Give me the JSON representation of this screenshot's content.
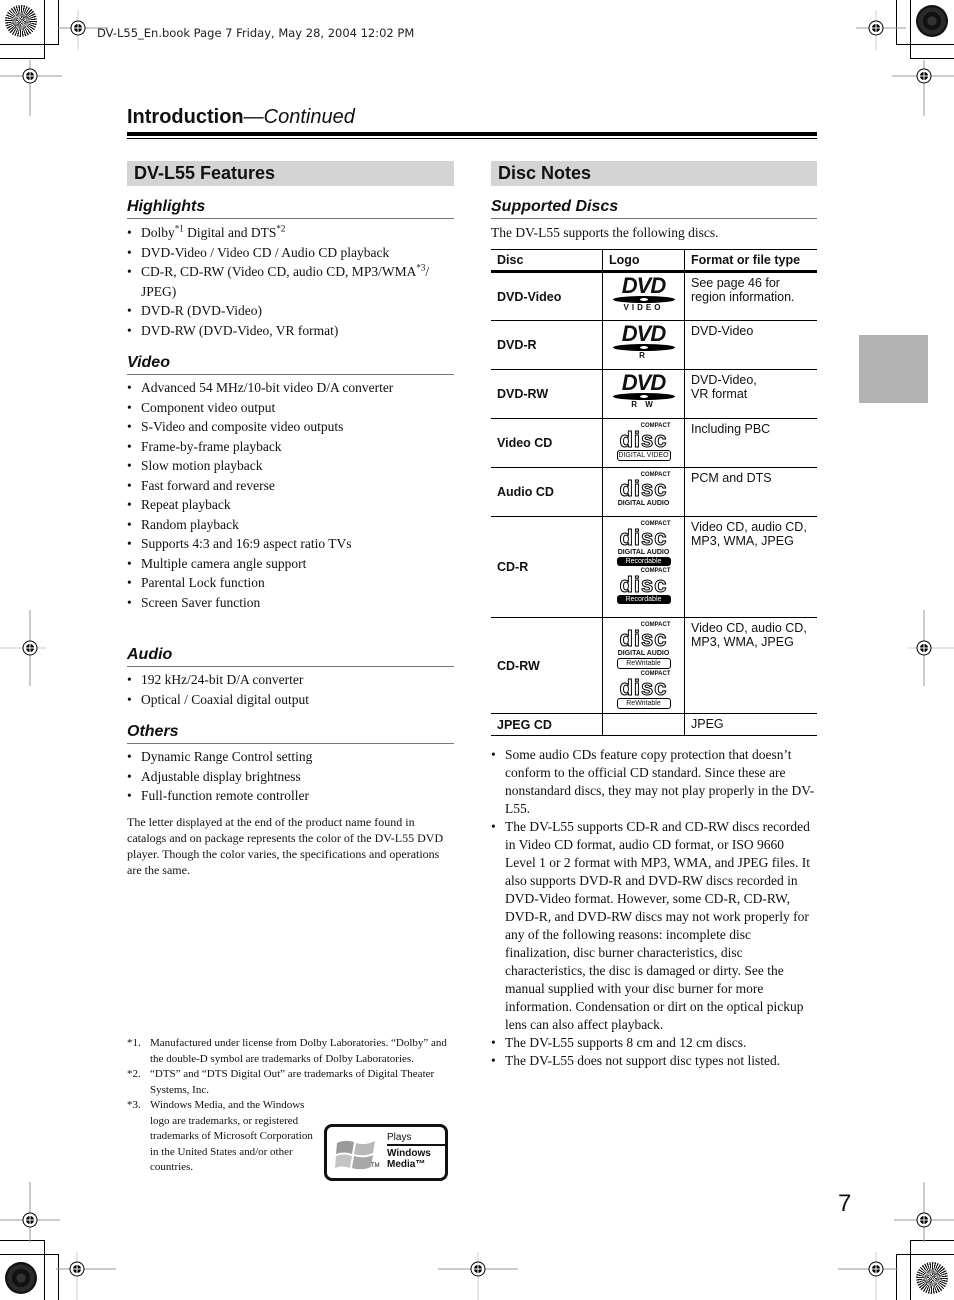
{
  "print_header": "DV-L55_En.book  Page 7  Friday, May 28, 2004  12:02 PM",
  "page": {
    "title": "Introduction",
    "title_continued": "—Continued",
    "number": "7"
  },
  "features": {
    "heading": "DV-L55 Features",
    "highlights": {
      "heading": "Highlights",
      "items": [
        {
          "text": "Dolby",
          "sup": "*1",
          "text2": " Digital and DTS",
          "sup2": "*2"
        },
        {
          "text": "DVD-Video / Video CD / Audio CD playback"
        },
        {
          "text": "CD-R, CD-RW (Video CD, audio CD, MP3/WMA",
          "sup": "*3",
          "text2": "/ JPEG)"
        },
        {
          "text": "DVD-R (DVD-Video)"
        },
        {
          "text": "DVD-RW (DVD-Video, VR format)"
        }
      ]
    },
    "video": {
      "heading": "Video",
      "items": [
        "Advanced 54 MHz/10-bit video D/A converter",
        "Component video output",
        "S-Video and composite video outputs",
        "Frame-by-frame playback",
        "Slow motion playback",
        "Fast forward and reverse",
        "Repeat playback",
        "Random playback",
        "Supports 4:3 and 16:9 aspect ratio TVs",
        "Multiple camera angle support",
        "Parental Lock function",
        "Screen Saver function"
      ]
    },
    "audio": {
      "heading": "Audio",
      "items": [
        "192 kHz/24-bit D/A converter",
        "Optical / Coaxial digital output"
      ]
    },
    "others": {
      "heading": "Others",
      "items": [
        "Dynamic Range Control setting",
        "Adjustable display brightness",
        "Full-function remote controller"
      ]
    },
    "color_note": "The letter displayed at the end of the product name found in catalogs and on package represents the color of the DV-L55 DVD player. Though the color varies, the specifications and operations are the same."
  },
  "footnotes": [
    {
      "num": "*1.",
      "text": "Manufactured under license from Dolby Laboratories. “Dolby” and the double-D symbol are trademarks of Dolby Laboratories."
    },
    {
      "num": "*2.",
      "text": "“DTS” and “DTS Digital Out” are trademarks of Digital Theater Systems, Inc."
    },
    {
      "num": "*3.",
      "text": "Windows Media, and the Windows logo are trademarks, or registered trademarks of Microsoft Corporation in the United States and/or other countries."
    }
  ],
  "windows_media_logo": {
    "line1": "Plays",
    "line2": "Windows",
    "line3": "Media™",
    "tm": "TM"
  },
  "disc_notes": {
    "heading": "Disc Notes",
    "supported": {
      "heading": "Supported Discs",
      "intro": "The DV-L55 supports the following discs.",
      "columns": [
        "Disc",
        "Logo",
        "Format or file type"
      ],
      "rows": [
        {
          "disc": "DVD-Video",
          "logo": "dvd-video-logo",
          "logo_sub": "VIDEO",
          "format": "See page 46 for region information."
        },
        {
          "disc": "DVD-R",
          "logo": "dvd-r-logo",
          "logo_sub": "R",
          "format": "DVD-Video"
        },
        {
          "disc": "DVD-RW",
          "logo": "dvd-rw-logo",
          "logo_sub": "R W",
          "format": "DVD-Video,\nVR format"
        },
        {
          "disc": "Video CD",
          "logo": "compact-disc-digital-video-logo",
          "format": "Including PBC"
        },
        {
          "disc": "Audio CD",
          "logo": "compact-disc-digital-audio-logo",
          "format": "PCM and DTS"
        },
        {
          "disc": "CD-R",
          "logo": "compact-disc-recordable-logos",
          "format": "Video CD, audio CD, MP3, WMA, JPEG"
        },
        {
          "disc": "CD-RW",
          "logo": "compact-disc-rewritable-logos",
          "format": "Video CD, audio CD, MP3, WMA, JPEG"
        },
        {
          "disc": "JPEG CD",
          "logo": "",
          "format": "JPEG"
        }
      ],
      "logo_text": {
        "compact": "COMPACT",
        "disc": "disc",
        "digital_video": "DIGITAL VIDEO",
        "digital_audio": "DIGITAL AUDIO",
        "recordable": "Recordable",
        "rewritable": "ReWritable",
        "dvd": "DVD"
      }
    },
    "notes": [
      "Some audio CDs feature copy protection that doesn’t conform to the official CD standard. Since these are nonstandard discs, they may not play properly in the DV-L55.",
      "The DV-L55 supports CD-R and CD-RW discs recorded in Video CD format, audio CD format, or ISO 9660 Level 1 or 2 format with MP3, WMA, and JPEG files. It also supports DVD-R and DVD-RW discs recorded in DVD-Video format. However, some CD-R, CD-RW, DVD-R, and DVD-RW discs may not work properly for any of the following reasons: incomplete disc finalization, disc burner characteristics, disc characteristics, the disc is damaged or dirty. See the manual supplied with your disc burner for more information. Condensation or dirt on the optical pickup lens can also affect playback.",
      "The DV-L55 supports 8 cm and 12 cm discs.",
      "The DV-L55 does not support disc types not listed."
    ]
  }
}
